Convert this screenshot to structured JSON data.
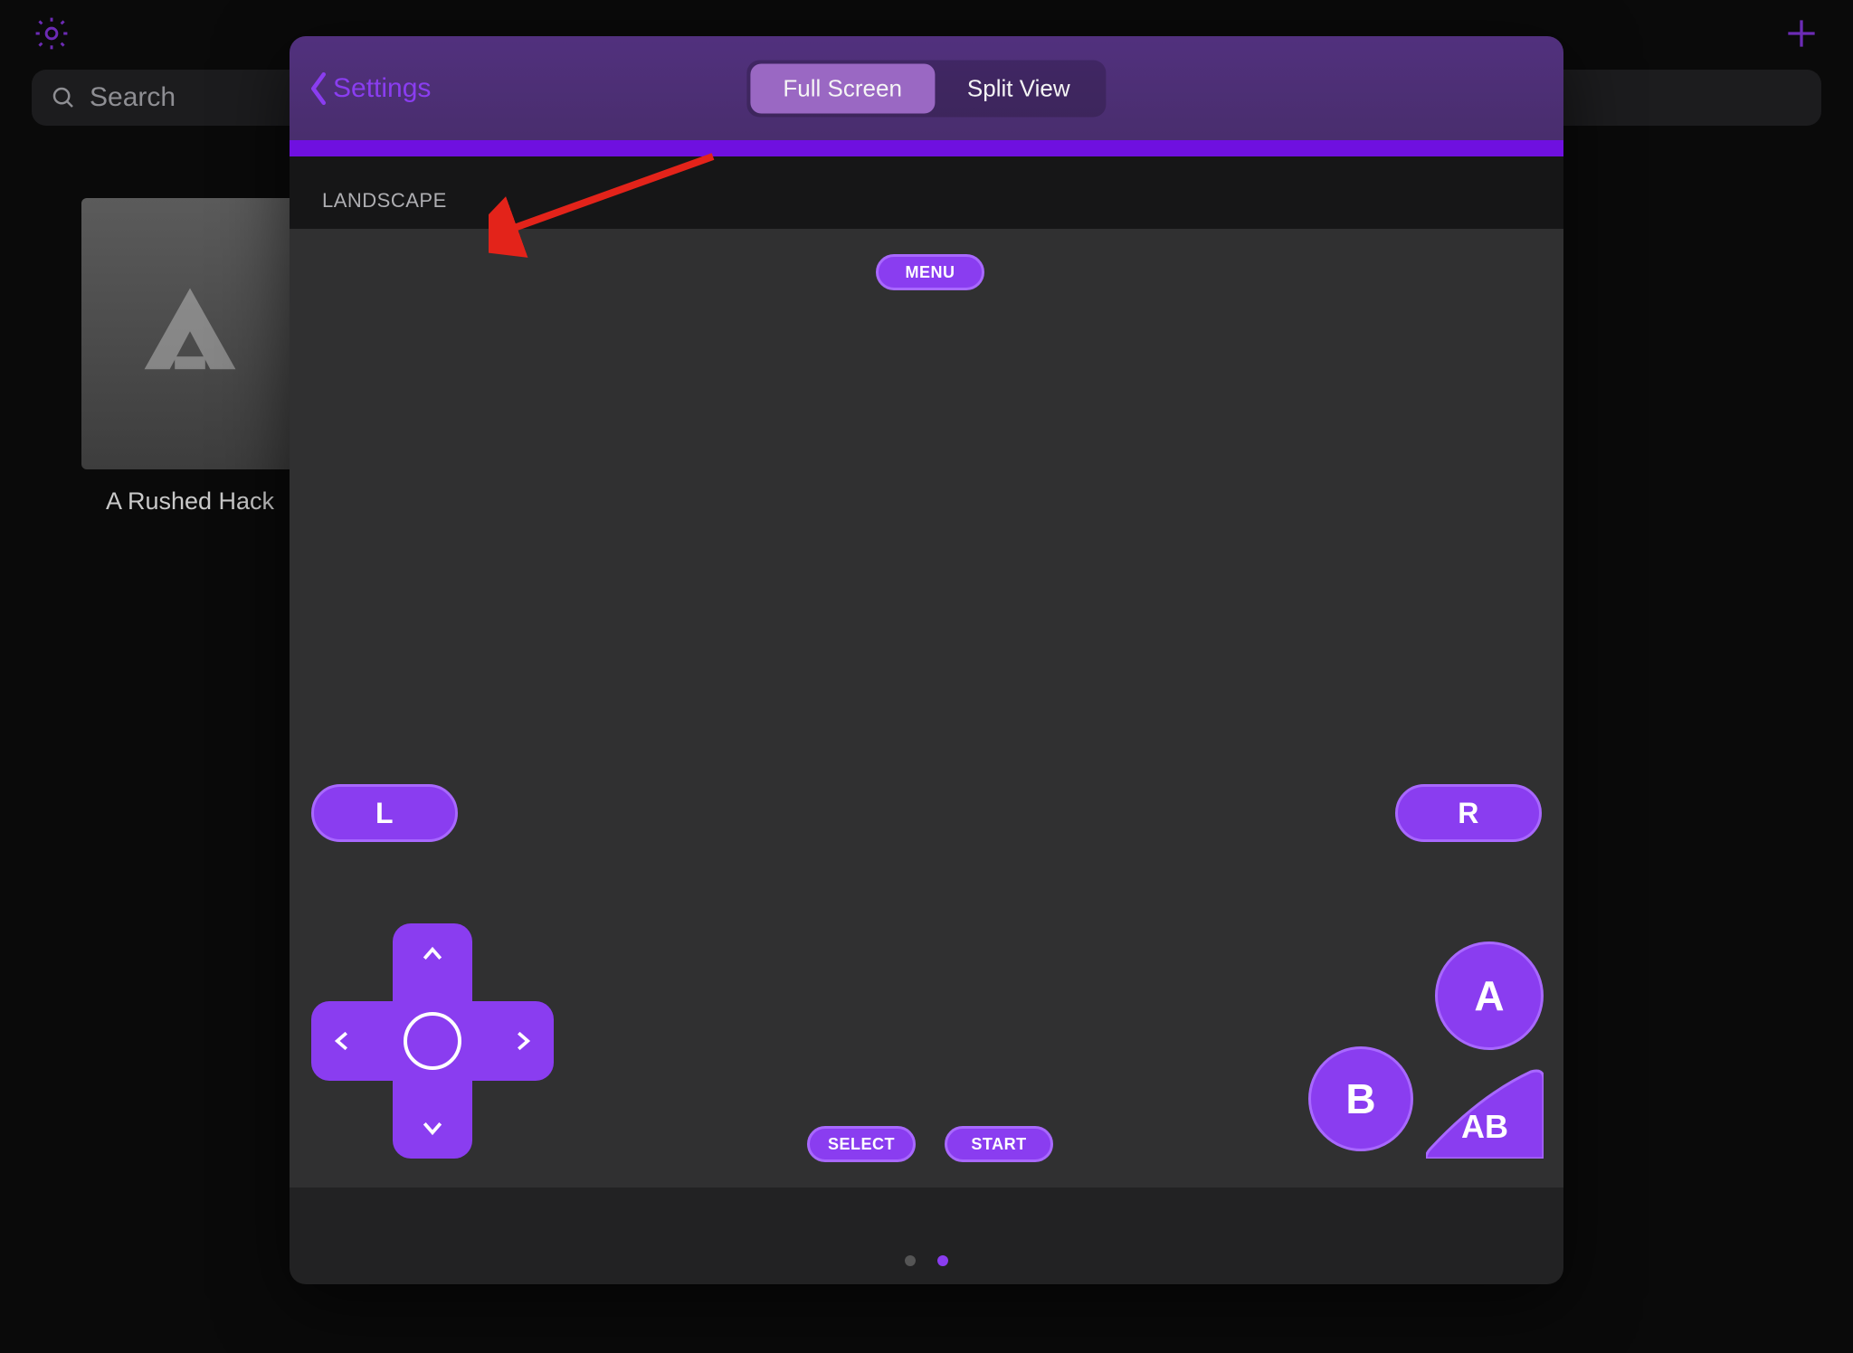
{
  "background": {
    "search_placeholder": "Search",
    "game_title": "A Rushed Hack"
  },
  "sheet": {
    "back_label": "Settings",
    "segments": {
      "full": "Full Screen",
      "split": "Split View"
    },
    "section_label": "LANDSCAPE",
    "buttons": {
      "menu": "MENU",
      "l": "L",
      "r": "R",
      "select": "SELECT",
      "start": "START",
      "a": "A",
      "b": "B",
      "ab": "AB"
    }
  }
}
